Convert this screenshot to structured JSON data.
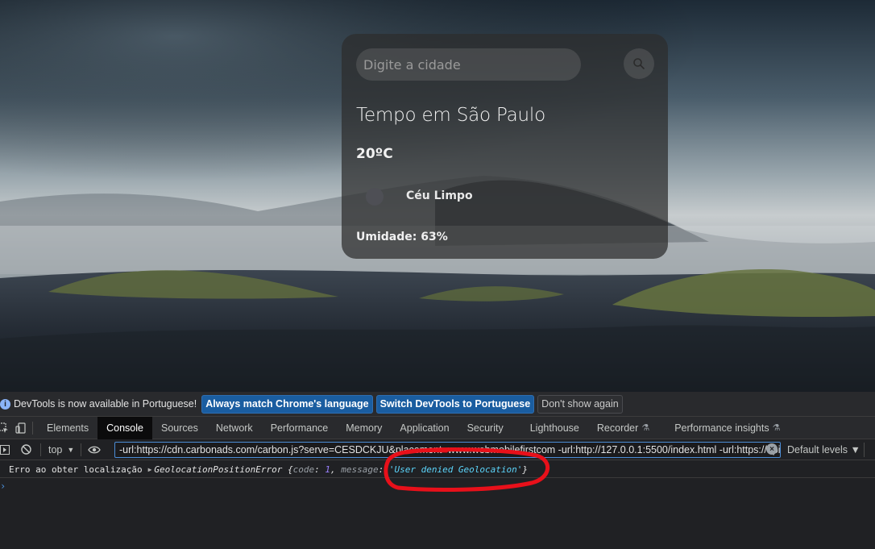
{
  "weather": {
    "search_placeholder": "Digite a cidade",
    "city_title": "Tempo em São Paulo",
    "temperature": "20ºC",
    "description": "Céu Limpo",
    "humidity": "Umidade: 63%"
  },
  "devtools": {
    "infobar": {
      "message": "DevTools is now available in Portuguese!",
      "match_button": "Always match Chrome's language",
      "switch_button": "Switch DevTools to Portuguese",
      "dismiss_button": "Don't show again"
    },
    "tabs": [
      {
        "label": "Elements"
      },
      {
        "label": "Console"
      },
      {
        "label": "Sources"
      },
      {
        "label": "Network"
      },
      {
        "label": "Performance"
      },
      {
        "label": "Memory"
      },
      {
        "label": "Application"
      },
      {
        "label": "Security"
      },
      {
        "label": "Lighthouse"
      },
      {
        "label": "Recorder"
      },
      {
        "label": "Performance insights"
      }
    ],
    "active_tab": "Console",
    "toolbar": {
      "context": "top",
      "filter_value": "-url:https://cdn.carbonads.com/carbon.js?serve=CESDCKJU&placement=www.webmobilefirstcom -url:http://127.0.0.1:5500/index.html -url:https://api.am",
      "levels": "Default levels ▼"
    },
    "console": {
      "message": "Erro ao obter localização",
      "error_type": "GeolocationPositionError",
      "code_key": "code",
      "code_value": "1",
      "message_key": "message",
      "message_value": "'User denied Geolocation'"
    }
  },
  "colors": {
    "active_tab_bg": "#0b0b0c",
    "info_button_blue": "#1a5da0",
    "annotation_red": "#e8101a",
    "string_cyan": "#5cd5fb",
    "number_purple": "#9980ff"
  }
}
